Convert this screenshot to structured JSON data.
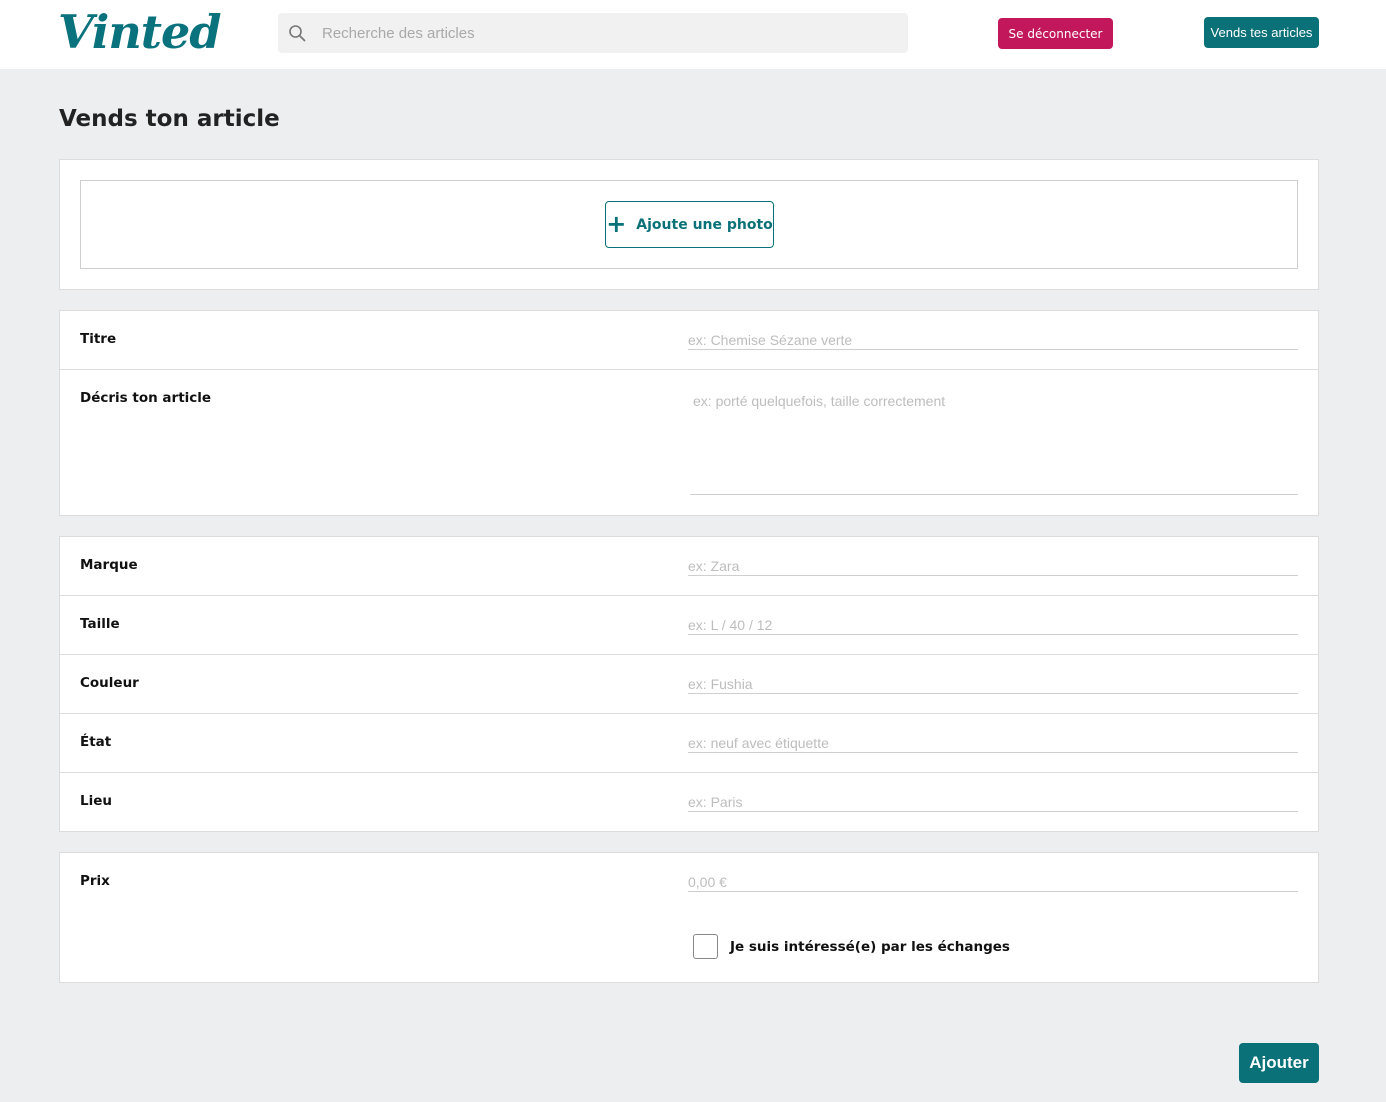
{
  "header": {
    "logo": "Vinted",
    "search": {
      "placeholder": "Recherche des articles",
      "value": ""
    },
    "logout_label": "Se déconnecter",
    "sell_label": "Vends tes articles"
  },
  "page": {
    "title": "Vends ton article"
  },
  "photo": {
    "add_label": "Ajoute une photo",
    "plus_glyph": "+"
  },
  "form": {
    "title": {
      "label": "Titre",
      "placeholder": "ex: Chemise Sézane verte",
      "value": ""
    },
    "description": {
      "label": "Décris ton article",
      "placeholder": "ex: porté quelquefois, taille correctement",
      "value": ""
    },
    "brand": {
      "label": "Marque",
      "placeholder": "ex: Zara",
      "value": ""
    },
    "size": {
      "label": "Taille",
      "placeholder": "ex: L / 40 / 12",
      "value": ""
    },
    "color": {
      "label": "Couleur",
      "placeholder": "ex: Fushia",
      "value": ""
    },
    "condition": {
      "label": "État",
      "placeholder": "ex: neuf avec étiquette",
      "value": ""
    },
    "location": {
      "label": "Lieu",
      "placeholder": "ex: Paris",
      "value": ""
    },
    "price": {
      "label": "Prix",
      "placeholder": "0,00 €",
      "value": ""
    },
    "exchange": {
      "label": "Je suis intéressé(e) par les échanges",
      "checked": false
    }
  },
  "submit_label": "Ajouter",
  "colors": {
    "brand_teal": "#09727d",
    "logout_pink": "#c2185b",
    "page_background": "#eceef0"
  },
  "icons": {
    "search": "search-icon",
    "plus": "plus-icon"
  }
}
